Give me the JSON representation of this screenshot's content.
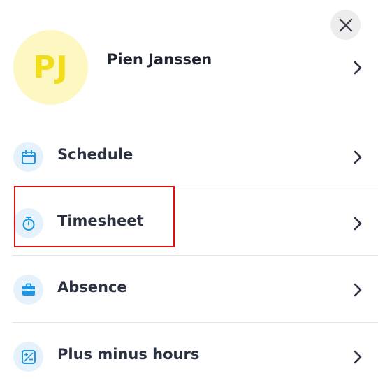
{
  "profile": {
    "initials": "PJ",
    "name": "Pien Janssen"
  },
  "menu": {
    "items": [
      {
        "label": "Schedule",
        "icon": "calendar-icon"
      },
      {
        "label": "Timesheet",
        "icon": "stopwatch-icon"
      },
      {
        "label": "Absence",
        "icon": "briefcase-icon"
      },
      {
        "label": "Plus minus hours",
        "icon": "plus-minus-icon"
      }
    ]
  },
  "colors": {
    "accent": "#2196e0",
    "icon_background": "#e6f2fb",
    "avatar_background": "#fdf8c2",
    "avatar_text": "#f2dd1a",
    "highlight": "#e01010"
  }
}
